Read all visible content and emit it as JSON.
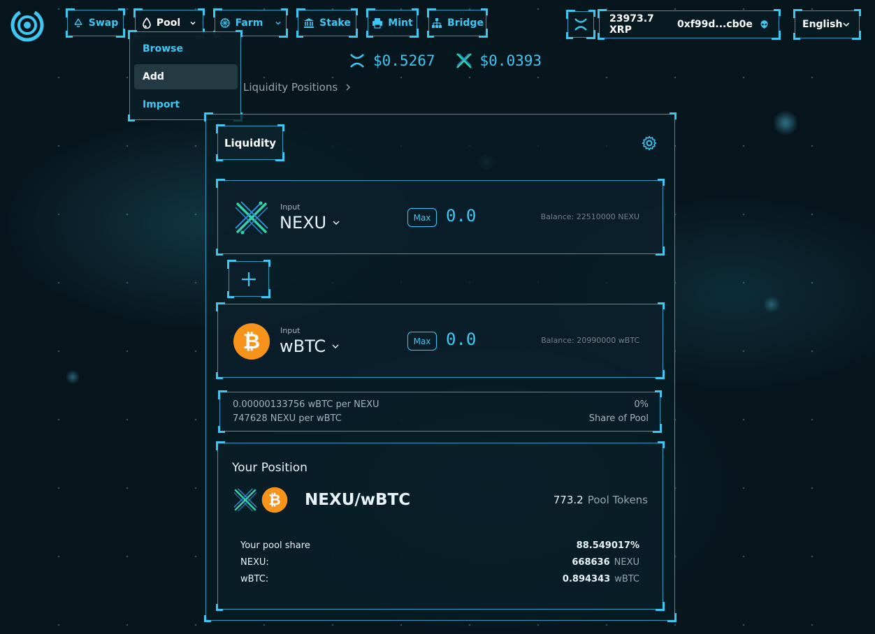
{
  "nav": {
    "swap": "Swap",
    "pool": "Pool",
    "farm": "Farm",
    "stake": "Stake",
    "mint": "Mint",
    "bridge": "Bridge"
  },
  "pool_menu": {
    "browse": "Browse",
    "add": "Add",
    "import": "Import"
  },
  "wallet": {
    "balance": "23973.7 XRP",
    "address": "0xf99d...cb0e"
  },
  "language": "English",
  "prices": {
    "xrp_price": "$0.5267",
    "nexu_price": "$0.0393"
  },
  "breadcrumb": {
    "current": "Liquidity Positions"
  },
  "card": {
    "tab_label": "Liquidity"
  },
  "token_a": {
    "label": "Input",
    "symbol": "NEXU",
    "max_label": "Max",
    "amount": "0.0",
    "balance": "Balance: 22510000 NEXU"
  },
  "token_b": {
    "label": "Input",
    "symbol": "wBTC",
    "max_label": "Max",
    "amount": "0.0",
    "balance": "Balance: 20990000 wBTC"
  },
  "rates": {
    "rate_a": "0.00000133756 wBTC per NEXU",
    "rate_b": "747628 NEXU per wBTC",
    "share_value": "0%",
    "share_label": "Share of Pool"
  },
  "position": {
    "title": "Your Position",
    "pair": "NEXU/wBTC",
    "pool_tokens_value": "773.2",
    "pool_tokens_label": "Pool Tokens",
    "pool_share_label": "Your pool share",
    "pool_share_value": "88.549017%",
    "nexu_label": "NEXU:",
    "nexu_value": "668636",
    "nexu_unit": "NEXU",
    "wbtc_label": "wBTC:",
    "wbtc_value": "0.894343",
    "wbtc_unit": "wBTC"
  },
  "colors": {
    "accent": "#3ec7f2",
    "bitcoin": "#f7931a",
    "background": "#07161d"
  },
  "icons": {
    "logo": "concentric-ring-logo",
    "swap": "recycle-icon",
    "pool": "droplet-icon",
    "farm": "sun-icon",
    "stake": "bank-icon",
    "mint": "printer-icon",
    "bridge": "network-icon",
    "xrp": "xrp-x-icon",
    "avatar": "alien-icon",
    "settings": "gear-icon",
    "add": "plus-icon"
  }
}
